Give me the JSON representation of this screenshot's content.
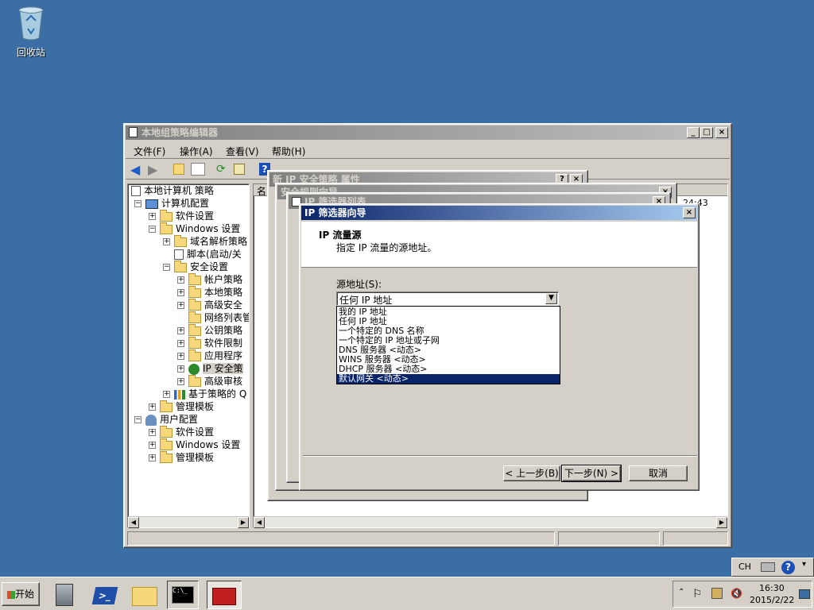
{
  "desktop": {
    "recycle_bin_label": "回收站"
  },
  "gpedit": {
    "title": "本地组策略编辑器",
    "menu": [
      "文件(F)",
      "操作(A)",
      "查看(V)",
      "帮助(H)"
    ],
    "list_header": "名",
    "list_time": "24:43",
    "tree": [
      {
        "label": "本地计算机 策略",
        "exp": ""
      },
      {
        "label": "计算机配置",
        "exp": "−"
      },
      {
        "label": "软件设置",
        "exp": "+"
      },
      {
        "label": "Windows 设置",
        "exp": "−"
      },
      {
        "label": "域名解析策略",
        "exp": "+"
      },
      {
        "label": "脚本(启动/关",
        "exp": ""
      },
      {
        "label": "安全设置",
        "exp": "−"
      },
      {
        "label": "帐户策略",
        "exp": "+"
      },
      {
        "label": "本地策略",
        "exp": "+"
      },
      {
        "label": "高级安全",
        "exp": "+"
      },
      {
        "label": "网络列表管",
        "exp": ""
      },
      {
        "label": "公钥策略",
        "exp": "+"
      },
      {
        "label": "软件限制",
        "exp": "+"
      },
      {
        "label": "应用程序",
        "exp": "+"
      },
      {
        "label": "IP 安全策",
        "exp": "+"
      },
      {
        "label": "高级审核",
        "exp": "+"
      },
      {
        "label": "基于策略的 Q",
        "exp": "+"
      },
      {
        "label": "管理模板",
        "exp": "+"
      },
      {
        "label": "用户配置",
        "exp": "−"
      },
      {
        "label": "软件设置",
        "exp": "+"
      },
      {
        "label": "Windows 设置",
        "exp": "+"
      },
      {
        "label": "管理模板",
        "exp": "+"
      }
    ]
  },
  "bg_dialogs": {
    "properties_title": "新 IP 安全策略 属性",
    "rules_title": "安全规则向导",
    "filter_list_title": "IP 筛选器列表"
  },
  "wizard": {
    "title": "IP 筛选器向导",
    "heading": "IP 流量源",
    "subheading": "指定 IP 流量的源地址。",
    "source_label": "源地址(S):",
    "selected_value": "任何 IP 地址",
    "options": [
      "我的 IP 地址",
      "任何 IP 地址",
      "一个特定的 DNS 名称",
      "一个特定的 IP 地址或子网",
      "DNS 服务器 <动态>",
      "WINS 服务器 <动态>",
      "DHCP 服务器 <动态>",
      "默认网关 <动态>"
    ],
    "highlighted_index": 7,
    "back_button": "< 上一步(B)",
    "next_button": "下一步(N) >",
    "cancel_button": "取消"
  },
  "taskbar": {
    "start_label": "开始",
    "lang": "CH",
    "clock_time": "16:30",
    "clock_date": "2015/2/22"
  },
  "colors": {
    "desktop": "#3a6ea5",
    "selection": "#0a246a",
    "window": "#d4d0c8"
  }
}
